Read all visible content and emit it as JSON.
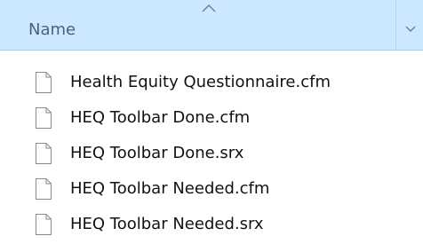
{
  "header": {
    "column_name": "Name",
    "sort_icon": "chevron-up-icon",
    "dropdown_icon": "chevron-down-icon"
  },
  "files": [
    {
      "name": "Health Equity Questionnaire.cfm",
      "icon": "file-icon"
    },
    {
      "name": "HEQ Toolbar Done.cfm",
      "icon": "file-icon"
    },
    {
      "name": "HEQ Toolbar Done.srx",
      "icon": "file-icon"
    },
    {
      "name": "HEQ Toolbar Needed.cfm",
      "icon": "file-icon"
    },
    {
      "name": "HEQ Toolbar Needed.srx",
      "icon": "file-icon"
    }
  ],
  "colors": {
    "header_bg": "#cce8ff",
    "header_text": "#4c607a",
    "text": "#111111"
  }
}
